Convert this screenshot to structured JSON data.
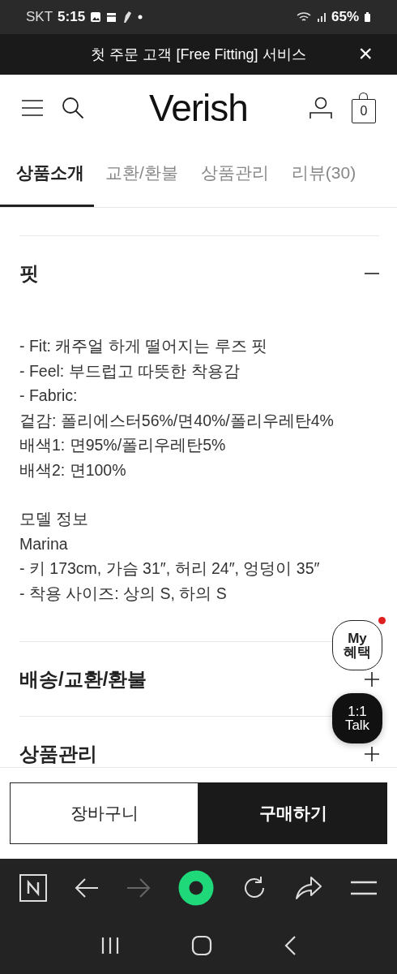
{
  "status_bar": {
    "carrier": "SKT",
    "time": "5:15",
    "battery": "65%"
  },
  "banner": {
    "text": "첫 주문 고객 [Free Fitting] 서비스",
    "close": "×"
  },
  "header": {
    "logo": "Verish",
    "cart_count": "0"
  },
  "tabs": [
    {
      "label": "상품소개",
      "selected": true
    },
    {
      "label": "교환/환불",
      "selected": false
    },
    {
      "label": "상품관리",
      "selected": false
    },
    {
      "label": "리뷰(30)",
      "selected": false
    }
  ],
  "sections": [
    {
      "title": "핏",
      "expanded": true,
      "paragraphs": [
        [
          "- Fit: 캐주얼 하게 떨어지는 루즈 핏",
          "- Feel: 부드럽고 따뜻한 착용감",
          "- Fabric:",
          "겉감: 폴리에스터56%/면40%/폴리우레탄4%",
          "배색1: 면95%/폴리우레탄5%",
          "배색2: 면100%"
        ],
        [
          "모델 정보",
          "Marina",
          "- 키 173cm, 가슴 31″, 허리 24″, 엉덩이 35″",
          "- 착용 사이즈: 상의 S, 하의 S"
        ]
      ]
    },
    {
      "title": "배송/교환/환불",
      "expanded": false
    },
    {
      "title": "상품관리",
      "expanded": false
    }
  ],
  "floating": {
    "benefit": {
      "lines": [
        "My",
        "혜택"
      ],
      "has_notification": true
    },
    "talk": {
      "lines": [
        "1:1",
        "Talk"
      ]
    }
  },
  "actions": {
    "cart": "장바구니",
    "buy": "구매하기"
  }
}
